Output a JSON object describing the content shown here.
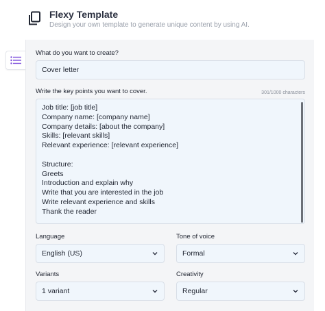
{
  "header": {
    "title": "Flexy Template",
    "subtitle": "Design your own template to generate unique content by using AI."
  },
  "form": {
    "create_label": "What do you want to create?",
    "create_value": "Cover letter",
    "keypoints_label": "Write the key points you want to cover.",
    "counter": "301/1000 characters",
    "keypoints_lines": [
      "Job title: [job title]",
      "Company name: [company name]",
      "Company details: [about the company]",
      "Skills: [relevant skills]",
      "Relevant experience: [relevant experience]",
      "",
      "Structure:",
      "Greets",
      "Introduction and explain why",
      "Write that you are interested in the job",
      "Write relevant experience and skills",
      "Thank the reader"
    ],
    "language_label": "Language",
    "language_value": "English (US)",
    "tone_label": "Tone of voice",
    "tone_value": "Formal",
    "variants_label": "Variants",
    "variants_value": "1 variant",
    "creativity_label": "Creativity",
    "creativity_value": "Regular"
  },
  "icons": {
    "header": "copy-icon",
    "side_tab": "list-icon",
    "select": "chevron-down-icon"
  },
  "colors": {
    "accent": "#7c4ddb",
    "field_bg": "#f0f6fc",
    "card_bg": "#f4f5f7"
  }
}
